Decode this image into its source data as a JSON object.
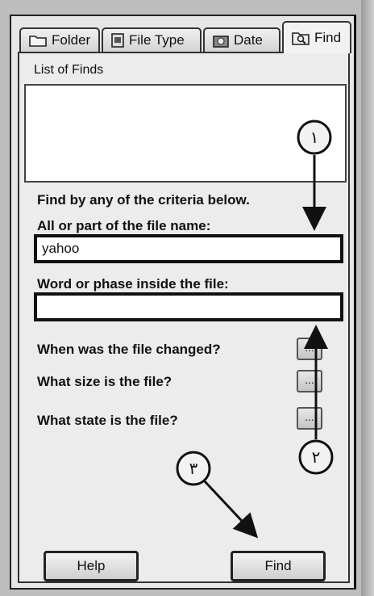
{
  "tabs": [
    {
      "label": "Folder",
      "icon": "folder-icon"
    },
    {
      "label": "File Type",
      "icon": "file-type-icon"
    },
    {
      "label": "Date",
      "icon": "date-icon"
    },
    {
      "label": "Find",
      "icon": "find-icon",
      "active": true
    }
  ],
  "find_panel": {
    "list_label": "List of Finds",
    "criteria_heading": "Find by any of the criteria below.",
    "name_label": "All or part of the file name:",
    "name_value": "yahoo",
    "phrase_label": "Word or phase inside the file:",
    "phrase_value": "",
    "changed_label": "When was the file changed?",
    "size_label": "What size is the file?",
    "state_label": "What state is the file?",
    "more_label": "..."
  },
  "buttons": {
    "help": "Help",
    "find": "Find"
  },
  "annotations": {
    "one": "١",
    "two": "٢",
    "three": "٣"
  }
}
